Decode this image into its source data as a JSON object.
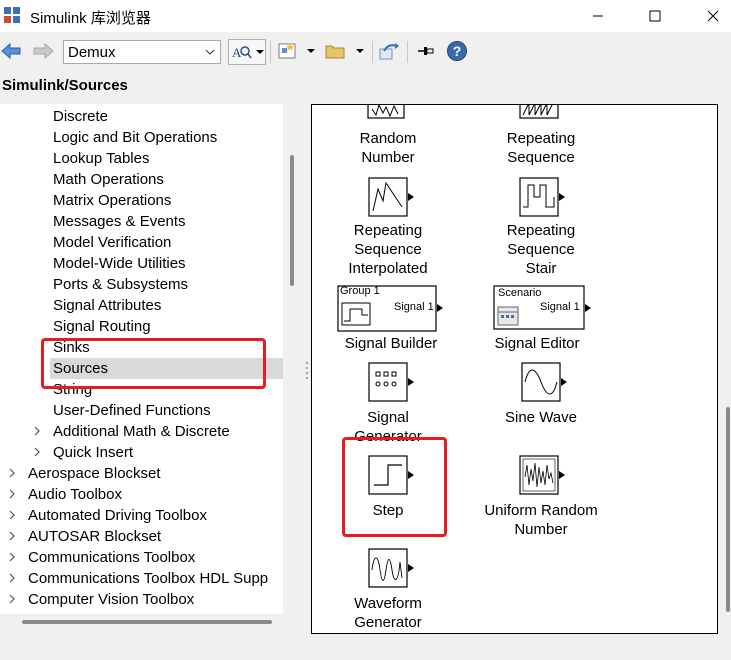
{
  "window": {
    "title": "Simulink 库浏览器"
  },
  "toolbar": {
    "search_value": "Demux"
  },
  "breadcrumb": "Simulink/Sources",
  "tree": {
    "sub_items": [
      "Discrete",
      "Logic and Bit Operations",
      "Lookup Tables",
      "Math Operations",
      "Matrix Operations",
      "Messages & Events",
      "Model Verification",
      "Model-Wide Utilities",
      "Ports & Subsystems",
      "Signal Attributes",
      "Signal Routing",
      "Sinks",
      "Sources",
      "String",
      "User-Defined Functions"
    ],
    "selected": "Sources",
    "sub_collapsed": [
      "Additional Math & Discrete",
      "Quick Insert"
    ],
    "toolboxes": [
      "Aerospace Blockset",
      "Audio Toolbox",
      "Automated Driving Toolbox",
      "AUTOSAR Blockset",
      "Communications Toolbox",
      "Communications Toolbox HDL Supp",
      "Computer Vision Toolbox"
    ]
  },
  "blocks": {
    "random_number": [
      "Random",
      "Number"
    ],
    "repeating_sequence": [
      "Repeating",
      "Sequence"
    ],
    "rep_seq_interp": [
      "Repeating",
      "Sequence",
      "Interpolated"
    ],
    "rep_seq_stair": [
      "Repeating",
      "Sequence",
      "Stair"
    ],
    "signal_builder": {
      "caption": "Signal Builder",
      "group": "Group 1",
      "out": "Signal 1"
    },
    "signal_editor": {
      "caption": "Signal Editor",
      "scenario": "Scenario",
      "out": "Signal 1"
    },
    "signal_generator": [
      "Signal",
      "Generator"
    ],
    "sine_wave": "Sine Wave",
    "step": "Step",
    "uniform_random": [
      "Uniform Random",
      "Number"
    ],
    "waveform_generator": [
      "Waveform",
      "Generator"
    ]
  },
  "colors": {
    "highlight_box": "#e81c1c",
    "selection": "#d9d9d9"
  }
}
